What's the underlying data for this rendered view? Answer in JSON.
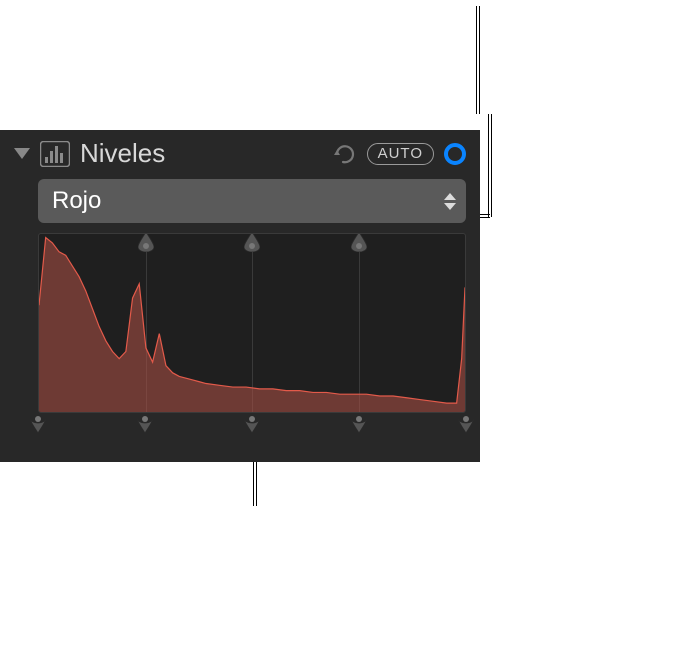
{
  "panel": {
    "title": "Niveles",
    "auto_label": "AUTO"
  },
  "channel_select": {
    "value": "Rojo"
  },
  "chart_data": {
    "type": "area",
    "title": "",
    "xlabel": "",
    "ylabel": "",
    "xlim": [
      0,
      255
    ],
    "ylim": [
      0,
      100
    ],
    "series": [
      {
        "name": "Rojo",
        "color": "#e35a4a",
        "x": [
          0,
          4,
          8,
          12,
          16,
          20,
          24,
          28,
          32,
          36,
          40,
          44,
          48,
          52,
          56,
          60,
          64,
          68,
          72,
          76,
          80,
          84,
          88,
          92,
          96,
          100,
          108,
          116,
          124,
          132,
          140,
          148,
          156,
          164,
          172,
          180,
          188,
          196,
          204,
          212,
          220,
          228,
          236,
          244,
          250,
          253,
          255
        ],
        "values": [
          60,
          98,
          95,
          90,
          88,
          82,
          76,
          68,
          58,
          48,
          40,
          34,
          30,
          34,
          64,
          72,
          36,
          28,
          44,
          26,
          22,
          20,
          19,
          18,
          17,
          16,
          15,
          14,
          14,
          13,
          13,
          12,
          12,
          11,
          11,
          10,
          10,
          10,
          9,
          9,
          8,
          7,
          6,
          5,
          5,
          30,
          70
        ]
      }
    ]
  },
  "markers": {
    "top": [
      25,
      50,
      75
    ],
    "bottom": [
      0,
      25,
      50,
      75,
      100
    ]
  }
}
